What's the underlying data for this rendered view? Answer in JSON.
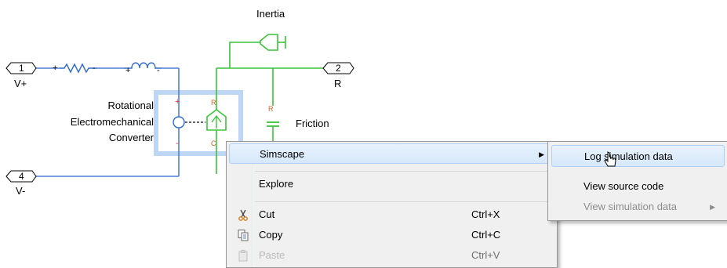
{
  "diagram": {
    "labels": {
      "inertia": "Inertia",
      "friction": "Friction",
      "converter_line1": "Rotational",
      "converter_line2": "Electromechanical",
      "converter_line3": "Converter"
    },
    "ports": [
      {
        "number": "1",
        "label": "V+"
      },
      {
        "number": "2",
        "label": "R"
      },
      {
        "number": "4",
        "label": "V-"
      }
    ],
    "block_marks": {
      "plus": "+",
      "minus": "-",
      "port_c": "C",
      "port_r": "R"
    },
    "colors": {
      "electrical_line": "#4f7ed6",
      "mechanical_line": "#39c439",
      "component": "#2f6ad0",
      "selection": "#bcd6f4"
    }
  },
  "context_menu": {
    "items": [
      {
        "label": "Simscape",
        "has_submenu": true,
        "highlighted": true
      },
      {
        "label": "Explore"
      },
      {
        "label": "Cut",
        "shortcut": "Ctrl+X",
        "icon": "scissors-icon"
      },
      {
        "label": "Copy",
        "shortcut": "Ctrl+C",
        "icon": "copy-icon"
      },
      {
        "label": "Paste",
        "shortcut": "Ctrl+V",
        "icon": "paste-icon",
        "disabled": true
      }
    ],
    "submenu": {
      "items": [
        {
          "label": "Log simulation data",
          "highlighted": true
        },
        {
          "label": "View source code"
        },
        {
          "label": "View simulation data",
          "disabled": true,
          "has_submenu": true
        }
      ]
    }
  }
}
